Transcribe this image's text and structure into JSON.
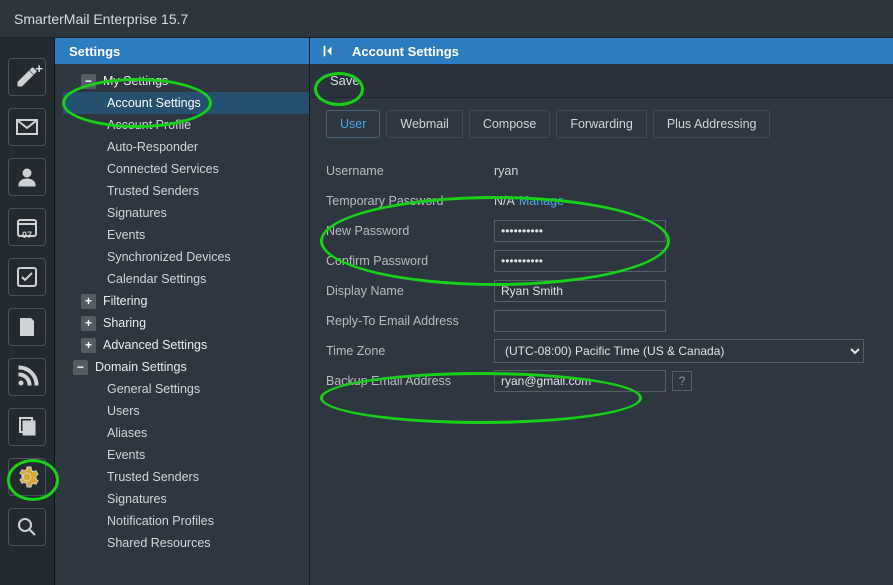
{
  "app_title": "SmarterMail Enterprise 15.7",
  "rail": {
    "compose_plus": "+",
    "calendar_day": "07"
  },
  "sidebar": {
    "header": "Settings",
    "sections": [
      {
        "label": "My Settings",
        "expanded": true,
        "items": [
          "Account Settings",
          "Account Profile",
          "Auto-Responder",
          "Connected Services",
          "Trusted Senders",
          "Signatures",
          "Events",
          "Synchronized Devices",
          "Calendar Settings"
        ],
        "collapsed_children": [
          "Filtering",
          "Sharing",
          "Advanced Settings"
        ]
      },
      {
        "label": "Domain Settings",
        "expanded": true,
        "items": [
          "General Settings",
          "Users",
          "Aliases",
          "Events",
          "Trusted Senders",
          "Signatures",
          "Notification Profiles",
          "Shared Resources"
        ]
      }
    ]
  },
  "content": {
    "header": "Account Settings",
    "toolbar": {
      "save": "Save"
    },
    "tabs": [
      "User",
      "Webmail",
      "Compose",
      "Forwarding",
      "Plus Addressing"
    ],
    "active_tab": 0,
    "form": {
      "username_label": "Username",
      "username_value": "ryan",
      "temp_pw_label": "Temporary Password",
      "temp_pw_value": "N/A",
      "temp_pw_manage": "Manage",
      "new_pw_label": "New Password",
      "new_pw_value": "••••••••••",
      "confirm_pw_label": "Confirm Password",
      "confirm_pw_value": "••••••••••",
      "display_name_label": "Display Name",
      "display_name_value": "Ryan Smith",
      "replyto_label": "Reply-To Email Address",
      "replyto_value": "",
      "timezone_label": "Time Zone",
      "timezone_value": "(UTC-08:00) Pacific Time (US & Canada)",
      "backup_label": "Backup Email Address",
      "backup_value": "ryan@gmail.com",
      "help_glyph": "?"
    }
  }
}
